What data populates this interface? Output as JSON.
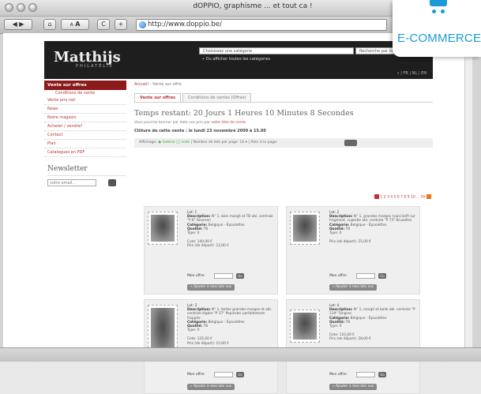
{
  "browser": {
    "window_title": "dOPPIO, graphisme ... et tout ca !",
    "url": "http://www.doppio.be/",
    "buttons": {
      "back": "◀",
      "forward": "▶",
      "home": "⌂",
      "text_smaller": "A",
      "text_larger": "A",
      "reload": "C",
      "add": "+"
    }
  },
  "badge": {
    "label": "E-COMMERCE",
    "icon": "cart-icon",
    "color": "#1a9bd7"
  },
  "site": {
    "logo": "Matthijs",
    "logo_sub": "PHILATÉLIE",
    "category_select": "Choisissez une catégorie",
    "category_hint": "» Ou afficher toutes les catégories",
    "search_placeholder": "Recherche par lot",
    "header_nav": "»  |  FR  |  NL  |  EN"
  },
  "sidebar": {
    "active": "Vente sur offres",
    "sub": "Conditions de vente",
    "items": [
      "Vente prix net",
      "News",
      "Notre magasin",
      "Acheter / vendre?",
      "Contact",
      "Plan",
      "Catalogues en PDF"
    ],
    "newsletter_title": "Newsletter",
    "newsletter_placeholder": "votre email..."
  },
  "main": {
    "breadcrumb_home": "Accueil",
    "breadcrumb_rest": "› Vente sur offre",
    "tabs": [
      "Vente sur offres",
      "Conditions de ventes (Offres)"
    ],
    "heading": "Temps restant: 20 Jours 1 Heures 10 Minutes 8 Secondes",
    "note_prefix": "Vous pourrez tourner par date vos prix par ",
    "note_link": "votre liste de vente",
    "closing": "Clôture de cette vente : le lundi 23 novembre 2009 à 15.00",
    "filter_text": "Affichage:",
    "filter_gallery": "Galerie",
    "filter_list": "Liste",
    "filter_per_page": "Nombre de lots par page:",
    "filter_per_page_value": "10",
    "filter_goto": "Aller à la page:",
    "pager": "1 2 3 4 5 6 7 8 9 10 ... 95"
  },
  "lots": [
    {
      "lot": "Lot: 1",
      "description": "N° 1, bien margé et TB obl. centrale \"P 8\" Beveren",
      "category": "Belgique - Épaulettes",
      "quality": "TB",
      "type": "0",
      "cote": "Cote: 140,00 €",
      "price": "Prix (de départ): 12,00 €",
      "offer_label": "Mon offre:",
      "go": "Go",
      "add": "» Ajouter à mes lots vus"
    },
    {
      "lot": "Lot: 2",
      "description": "N° 1, grandes marges (voisi bdf) sur fragment, superbe obl. centrale \"P 73\" Bruxelles",
      "category": "Belgique - Épaulettes",
      "quality": "TB",
      "type": "0",
      "cote": "",
      "price": "Prix (de départ): 25,00 €",
      "offer_label": "Mon offre:",
      "go": "Go",
      "add": "» Ajouter à mes lots vus"
    },
    {
      "lot": "Lot: 3",
      "description": "N° 1, belles grandes marges et obl. centrale légère \"P 37\" Pepinster parfaitement frappée",
      "category": "Belgique - Épaulettes",
      "quality": "TB",
      "type": "0",
      "cote": "Cote: 135,00 €",
      "price": "Prix (de départ): 15,00 €",
      "offer_label": "Mon offre:",
      "go": "Go",
      "add": "» Ajouter à mes lots vus"
    },
    {
      "lot": "Lot: 4",
      "description": "N° 1, margé et belle obl. centrale \"P 119\" Tongres",
      "category": "Belgique - Épaulettes",
      "quality": "TB",
      "type": "0",
      "cote": "Cote: 110,00 €",
      "price": "Prix (de départ): 28,00 €",
      "offer_label": "Mon offre:",
      "go": "Go",
      "add": "» Ajouter à mes lots vus"
    }
  ]
}
